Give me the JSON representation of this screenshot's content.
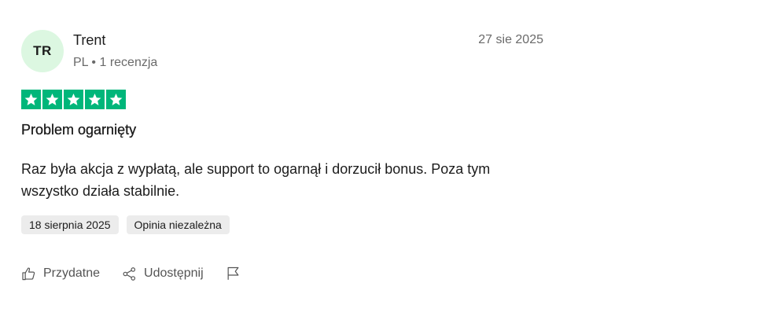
{
  "reviewer": {
    "initials": "TR",
    "name": "Trent",
    "meta": "PL • 1 recenzja"
  },
  "review": {
    "date": "27 sie 2025",
    "rating": 5,
    "title": "Problem ogarnięty",
    "body": "Raz była akcja z wypłatą, ale support to ogarnął i dorzucił bonus. Poza tym wszystko działa stabilnie."
  },
  "tags": {
    "experience_date": "18 sierpnia 2025",
    "verification": "Opinia niezależna"
  },
  "actions": {
    "helpful_label": "Przydatne",
    "share_label": "Udostępnij"
  },
  "icons": {
    "star": "star-icon",
    "helpful": "thumbs-up-icon",
    "share": "share-icon",
    "report": "flag-icon"
  },
  "colors": {
    "star_background": "#00b67a",
    "avatar_background": "#dcf7e1"
  }
}
